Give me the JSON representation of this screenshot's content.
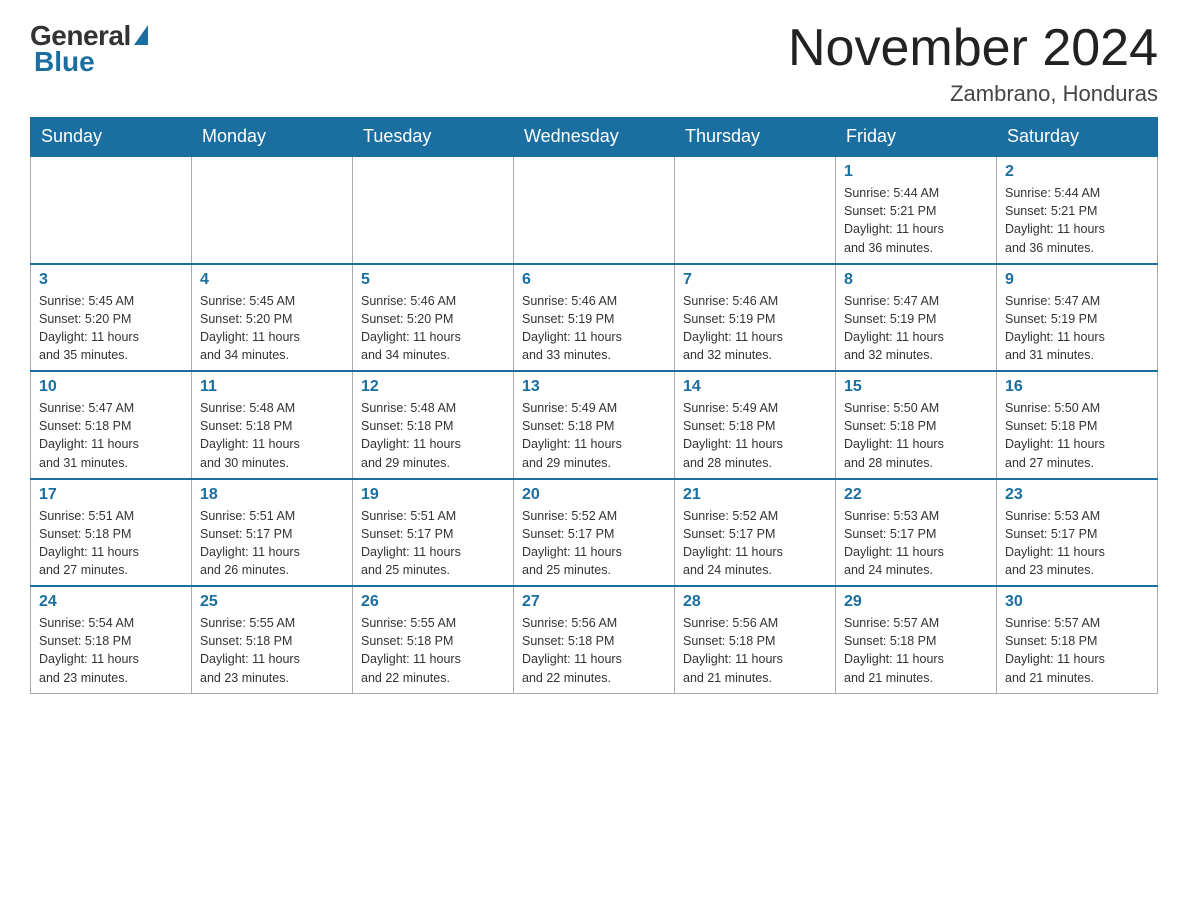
{
  "logo": {
    "general": "General",
    "blue": "Blue"
  },
  "header": {
    "title": "November 2024",
    "location": "Zambrano, Honduras"
  },
  "days_of_week": [
    "Sunday",
    "Monday",
    "Tuesday",
    "Wednesday",
    "Thursday",
    "Friday",
    "Saturday"
  ],
  "weeks": [
    [
      {
        "day": "",
        "info": ""
      },
      {
        "day": "",
        "info": ""
      },
      {
        "day": "",
        "info": ""
      },
      {
        "day": "",
        "info": ""
      },
      {
        "day": "",
        "info": ""
      },
      {
        "day": "1",
        "info": "Sunrise: 5:44 AM\nSunset: 5:21 PM\nDaylight: 11 hours\nand 36 minutes."
      },
      {
        "day": "2",
        "info": "Sunrise: 5:44 AM\nSunset: 5:21 PM\nDaylight: 11 hours\nand 36 minutes."
      }
    ],
    [
      {
        "day": "3",
        "info": "Sunrise: 5:45 AM\nSunset: 5:20 PM\nDaylight: 11 hours\nand 35 minutes."
      },
      {
        "day": "4",
        "info": "Sunrise: 5:45 AM\nSunset: 5:20 PM\nDaylight: 11 hours\nand 34 minutes."
      },
      {
        "day": "5",
        "info": "Sunrise: 5:46 AM\nSunset: 5:20 PM\nDaylight: 11 hours\nand 34 minutes."
      },
      {
        "day": "6",
        "info": "Sunrise: 5:46 AM\nSunset: 5:19 PM\nDaylight: 11 hours\nand 33 minutes."
      },
      {
        "day": "7",
        "info": "Sunrise: 5:46 AM\nSunset: 5:19 PM\nDaylight: 11 hours\nand 32 minutes."
      },
      {
        "day": "8",
        "info": "Sunrise: 5:47 AM\nSunset: 5:19 PM\nDaylight: 11 hours\nand 32 minutes."
      },
      {
        "day": "9",
        "info": "Sunrise: 5:47 AM\nSunset: 5:19 PM\nDaylight: 11 hours\nand 31 minutes."
      }
    ],
    [
      {
        "day": "10",
        "info": "Sunrise: 5:47 AM\nSunset: 5:18 PM\nDaylight: 11 hours\nand 31 minutes."
      },
      {
        "day": "11",
        "info": "Sunrise: 5:48 AM\nSunset: 5:18 PM\nDaylight: 11 hours\nand 30 minutes."
      },
      {
        "day": "12",
        "info": "Sunrise: 5:48 AM\nSunset: 5:18 PM\nDaylight: 11 hours\nand 29 minutes."
      },
      {
        "day": "13",
        "info": "Sunrise: 5:49 AM\nSunset: 5:18 PM\nDaylight: 11 hours\nand 29 minutes."
      },
      {
        "day": "14",
        "info": "Sunrise: 5:49 AM\nSunset: 5:18 PM\nDaylight: 11 hours\nand 28 minutes."
      },
      {
        "day": "15",
        "info": "Sunrise: 5:50 AM\nSunset: 5:18 PM\nDaylight: 11 hours\nand 28 minutes."
      },
      {
        "day": "16",
        "info": "Sunrise: 5:50 AM\nSunset: 5:18 PM\nDaylight: 11 hours\nand 27 minutes."
      }
    ],
    [
      {
        "day": "17",
        "info": "Sunrise: 5:51 AM\nSunset: 5:18 PM\nDaylight: 11 hours\nand 27 minutes."
      },
      {
        "day": "18",
        "info": "Sunrise: 5:51 AM\nSunset: 5:17 PM\nDaylight: 11 hours\nand 26 minutes."
      },
      {
        "day": "19",
        "info": "Sunrise: 5:51 AM\nSunset: 5:17 PM\nDaylight: 11 hours\nand 25 minutes."
      },
      {
        "day": "20",
        "info": "Sunrise: 5:52 AM\nSunset: 5:17 PM\nDaylight: 11 hours\nand 25 minutes."
      },
      {
        "day": "21",
        "info": "Sunrise: 5:52 AM\nSunset: 5:17 PM\nDaylight: 11 hours\nand 24 minutes."
      },
      {
        "day": "22",
        "info": "Sunrise: 5:53 AM\nSunset: 5:17 PM\nDaylight: 11 hours\nand 24 minutes."
      },
      {
        "day": "23",
        "info": "Sunrise: 5:53 AM\nSunset: 5:17 PM\nDaylight: 11 hours\nand 23 minutes."
      }
    ],
    [
      {
        "day": "24",
        "info": "Sunrise: 5:54 AM\nSunset: 5:18 PM\nDaylight: 11 hours\nand 23 minutes."
      },
      {
        "day": "25",
        "info": "Sunrise: 5:55 AM\nSunset: 5:18 PM\nDaylight: 11 hours\nand 23 minutes."
      },
      {
        "day": "26",
        "info": "Sunrise: 5:55 AM\nSunset: 5:18 PM\nDaylight: 11 hours\nand 22 minutes."
      },
      {
        "day": "27",
        "info": "Sunrise: 5:56 AM\nSunset: 5:18 PM\nDaylight: 11 hours\nand 22 minutes."
      },
      {
        "day": "28",
        "info": "Sunrise: 5:56 AM\nSunset: 5:18 PM\nDaylight: 11 hours\nand 21 minutes."
      },
      {
        "day": "29",
        "info": "Sunrise: 5:57 AM\nSunset: 5:18 PM\nDaylight: 11 hours\nand 21 minutes."
      },
      {
        "day": "30",
        "info": "Sunrise: 5:57 AM\nSunset: 5:18 PM\nDaylight: 11 hours\nand 21 minutes."
      }
    ]
  ]
}
